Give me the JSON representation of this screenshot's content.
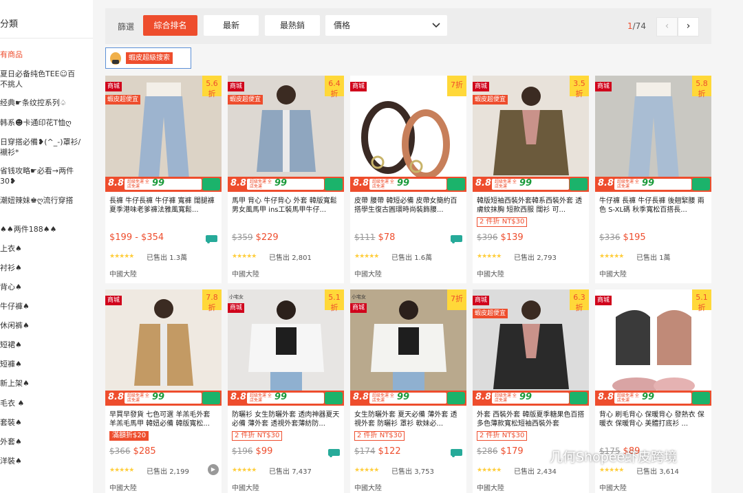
{
  "sidebar": {
    "title": "分類",
    "items": [
      {
        "label": "有商品",
        "active": true
      },
      {
        "label": "夏日必备纯色TEE☺百\n不挑人"
      },
      {
        "label": "经典☛条纹控系列♤"
      },
      {
        "label": "韩系☻卡通印花T恤ღ"
      },
      {
        "label": "日穿搭必備❥(^_-)罩衫/\n襯衫*"
      },
      {
        "label": "省钱攻略☛必看→两件\n30❥"
      },
      {
        "label": "潮妞辣妹♚ღ流行穿搭"
      },
      {
        "label": "♠♠两件188♠♠"
      },
      {
        "label": "上衣♠"
      },
      {
        "label": "衬衫♠"
      },
      {
        "label": "背心♠"
      },
      {
        "label": "牛仔褲♠"
      },
      {
        "label": "休闲裤♠"
      },
      {
        "label": "短裙♠"
      },
      {
        "label": "短褲♠"
      },
      {
        "label": "新上架♠"
      },
      {
        "label": "毛衣 ♠"
      },
      {
        "label": "套裝♠"
      },
      {
        "label": "外套♠"
      },
      {
        "label": "洋裝♠"
      }
    ]
  },
  "filter": {
    "label": "篩選",
    "buttons": [
      "綜合排名",
      "最新",
      "最熱銷"
    ],
    "active_index": 0,
    "price_select": "價格",
    "page_current": "1",
    "page_total": "/74",
    "prev": "‹",
    "next": "›"
  },
  "super_search": {
    "label": "蝦皮超級搜索"
  },
  "card_labels": {
    "mall": "商城",
    "cheap": "蝦皮超便宜",
    "b88": "8.8",
    "banner_sub": "超級免運 全店免運",
    "banner_99": "99",
    "location": "中國大陸",
    "sold_prefix": "已售出 "
  },
  "products": [
    {
      "title": "長褲 牛仔長褲 牛仔褲 寬褲 闊腿褲 夏季港味老爹褲法雅風寬鬆...",
      "discount": "5.6折",
      "cheap": true,
      "brand": "",
      "promo": "",
      "old_price": "",
      "price": "$199 - $354",
      "free": true,
      "stars": "★★★★★",
      "sold": "1.3萬",
      "img": {
        "bg": "#dcd3c6",
        "fg": "#9db4cf",
        "shape": "pants"
      }
    },
    {
      "title": "馬甲 背心 牛仔背心 外套 韓版寬鬆男女風馬甲 ins工裝馬甲牛仔...",
      "discount": "6.4折",
      "cheap": true,
      "brand": "",
      "promo": "",
      "old_price": "$359",
      "price": "$229",
      "free": false,
      "stars": "★★★★★",
      "sold": "2,801",
      "img": {
        "bg": "#ddd8d2",
        "fg": "#8fa6bf",
        "shape": "vest"
      }
    },
    {
      "title": "皮帶 腰帶 韓短必備 皮帶女簡約百搭學生復古圓環時尚裝飾腰...",
      "discount": "7折",
      "cheap": false,
      "brand": "",
      "promo": "",
      "old_price": "$111",
      "price": "$78",
      "free": true,
      "stars": "★★★★★",
      "sold": "1.6萬",
      "img": {
        "bg": "#ffffff",
        "fg": "#3a2a24",
        "shape": "belt"
      }
    },
    {
      "title": "韓版短袖西裝外套韓系西裝外套 透膚紋抹胸 短款西服 闊衫 可...",
      "discount": "3.5折",
      "cheap": true,
      "brand": "",
      "promo": "2 件折 NT$30",
      "promo_fill": false,
      "old_price": "$396",
      "price": "$139",
      "free": false,
      "stars": "★★★★★",
      "sold": "2,793",
      "img": {
        "bg": "#e8e2da",
        "fg": "#6b5a3c",
        "shape": "blazer"
      }
    },
    {
      "title": "牛仔褲 長褲 牛仔長褲 後翹緊腰 兩色 S-XL碼 秋季寬松百搭長...",
      "discount": "5.8折",
      "cheap": false,
      "brand": "",
      "promo": "",
      "old_price": "$336",
      "price": "$195",
      "free": false,
      "stars": "★★★★★",
      "sold": "1萬",
      "img": {
        "bg": "#c9c8c2",
        "fg": "#a9bdd3",
        "shape": "pants"
      }
    },
    {
      "title": "早買早發貨 七色可選 羊羔毛外套 羊羔毛馬甲 韓妞必備 韓版寬松...",
      "discount": "7.8折",
      "cheap": false,
      "brand": "",
      "promo": "滿額折$20",
      "promo_fill": true,
      "old_price": "$366",
      "price": "$285",
      "free": false,
      "stars": "★★★★★",
      "sold": "2,199",
      "play": true,
      "img": {
        "bg": "#efe9e1",
        "fg": "#c39a64",
        "shape": "vest"
      }
    },
    {
      "title": "防曬衫 女生防曬外套 透肉神器夏天必備 薄外套 透視外套薄紡防...",
      "discount": "5.1折",
      "cheap": false,
      "brand": "小宅女",
      "promo": "2 件折 NT$30",
      "promo_fill": false,
      "old_price": "$196",
      "price": "$99",
      "free": true,
      "stars": "★★★★★",
      "sold": "7,437",
      "img": {
        "bg": "#e7e5e3",
        "fg": "#f6f6f6",
        "shape": "shirt"
      }
    },
    {
      "title": "女生防曬外套 夏天必備 薄外套 透視外套 防曬衫 罩衫 軟妹必...",
      "discount": "7折",
      "cheap": false,
      "brand": "小宅女",
      "promo": "2 件折 NT$30",
      "promo_fill": false,
      "old_price": "$174",
      "price": "$122",
      "free": true,
      "stars": "★★★★★",
      "sold": "3,753",
      "img": {
        "bg": "#b9a98d",
        "fg": "#f3f3f0",
        "shape": "shirt"
      }
    },
    {
      "title": "外套 西裝外套 韓版夏季糖果色百搭多色薄款寬松短袖西裝外套",
      "discount": "6.3折",
      "cheap": true,
      "brand": "",
      "promo": "2 件折 NT$30",
      "promo_fill": false,
      "old_price": "$286",
      "price": "$179",
      "free": false,
      "stars": "★★★★★",
      "sold": "2,434",
      "img": {
        "bg": "#dcdcdc",
        "fg": "#2a2a2a",
        "shape": "blazer"
      }
    },
    {
      "title": "背心 刷毛背心 保暖背心 發熱衣 保暖衣 保暖背心 美體打底衫 ...",
      "discount": "5.1折",
      "cheap": false,
      "brand": "",
      "promo": "",
      "old_price": "$175",
      "price": "$89",
      "free": false,
      "stars": "★★★★★",
      "sold": "3,614",
      "img": {
        "bg": "#ffffff",
        "fg": "#3a3a3a",
        "shape": "bra"
      }
    }
  ],
  "watermark": {
    "text": "几何Shopee虾皮跨境"
  }
}
